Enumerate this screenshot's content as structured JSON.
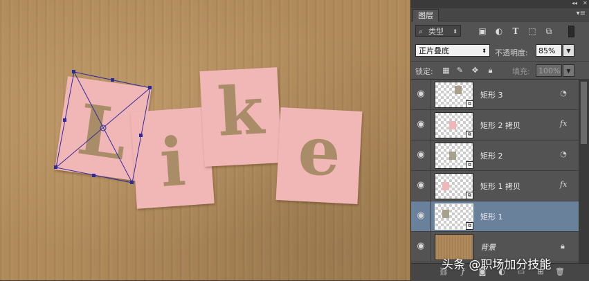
{
  "canvas": {
    "letters": [
      "L",
      "i",
      "k",
      "e"
    ],
    "card_color": "#f1b7b6",
    "letter_color": "#a98d68",
    "background_texture": "cardboard"
  },
  "panel": {
    "tab_title": "图层",
    "collapse_icon": "double-chevron-left-icon",
    "menu_icon": "panel-menu-icon",
    "filter": {
      "search_icon": "search-icon",
      "kind_label": "类型",
      "filter_icons": [
        "image-filter-icon",
        "adjustment-filter-icon",
        "type-filter-icon",
        "shape-filter-icon",
        "smart-object-filter-icon"
      ]
    },
    "blend_mode": "正片叠底",
    "opacity_label": "不透明度:",
    "opacity_value": "85%",
    "lock_label": "锁定:",
    "lock_icons": [
      "lock-transparent-icon",
      "lock-image-icon",
      "lock-position-icon",
      "lock-all-icon"
    ],
    "fill_label": "填充:",
    "fill_value": "100%",
    "layers": [
      {
        "name": "矩形 3",
        "effect": "style",
        "selected": false
      },
      {
        "name": "矩形 2 拷贝",
        "effect": "fx",
        "selected": false
      },
      {
        "name": "矩形 2",
        "effect": "style",
        "selected": false
      },
      {
        "name": "矩形 1 拷贝",
        "effect": "fx",
        "selected": false
      },
      {
        "name": "矩形 1",
        "effect": "none",
        "selected": true
      },
      {
        "name": "背景",
        "effect": "lock",
        "selected": false
      }
    ],
    "fx_text": "fx",
    "footer_icons": [
      "link-icon",
      "fx-icon",
      "mask-icon",
      "adjustment-icon",
      "folder-icon",
      "new-layer-icon",
      "trash-icon"
    ]
  },
  "watermark": "头条 @职场加分技能",
  "colors": {
    "panel_bg": "#535353",
    "selected_layer": "#6a819c",
    "transform_handle": "#2f2a9a"
  }
}
